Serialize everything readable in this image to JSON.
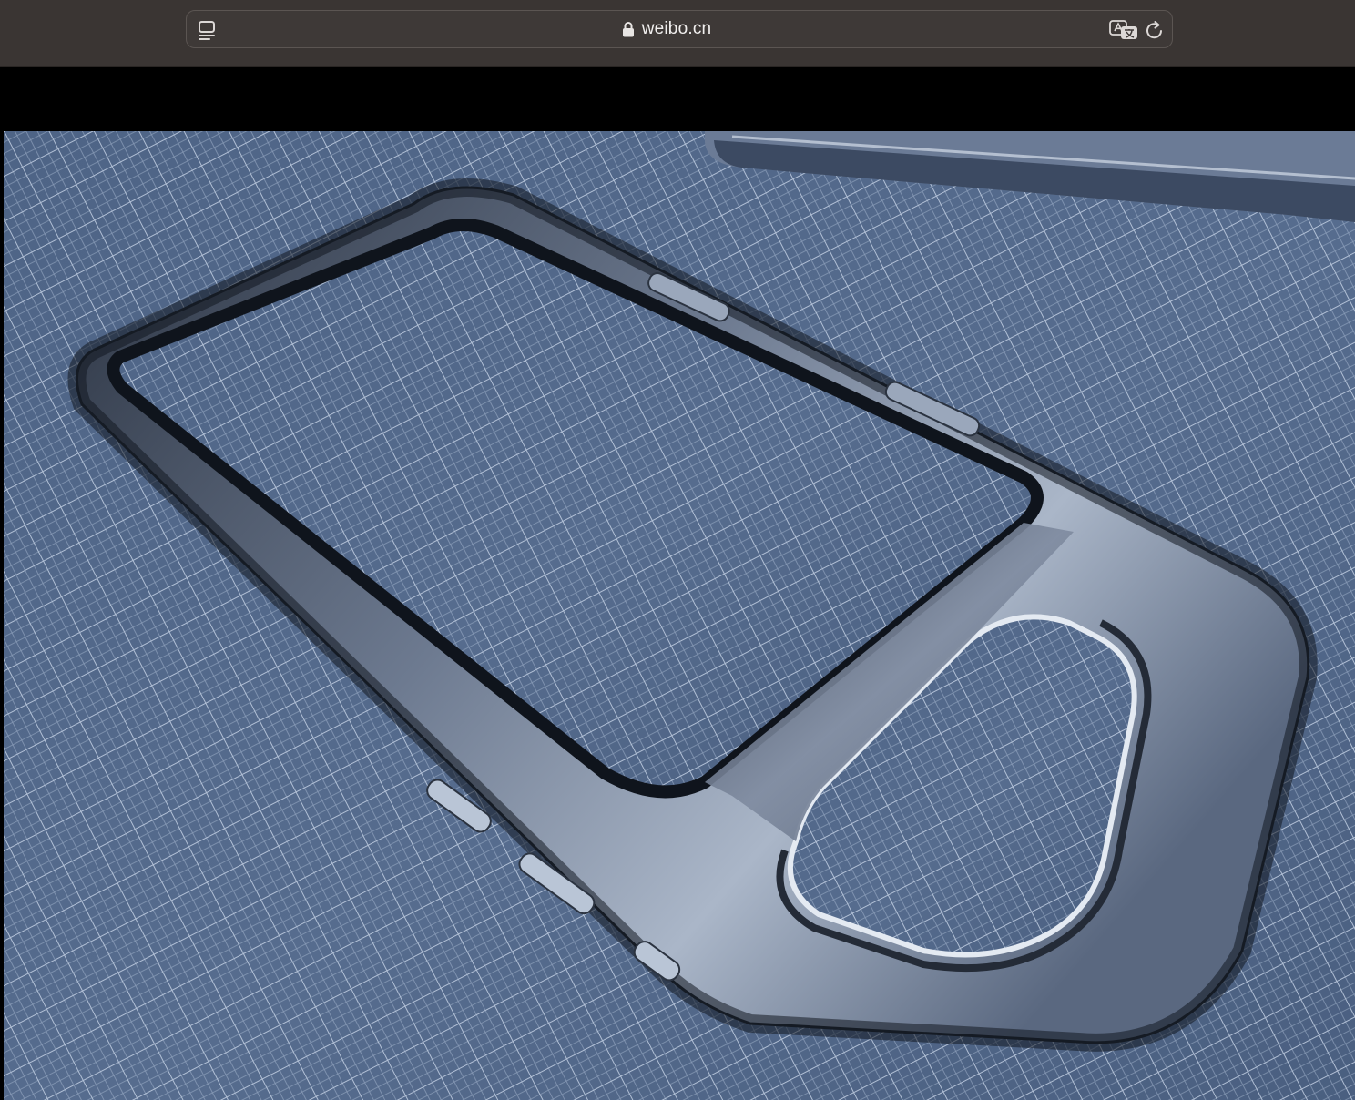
{
  "browser": {
    "url": "weibo.cn",
    "icons": {
      "tabs": "tab-overview-icon",
      "lock": "lock-icon",
      "translate": "translate-icon",
      "reload": "reload-icon"
    },
    "colors": {
      "toolbar": "#3a3533",
      "address_bar": "#3e3937",
      "text": "#f1efee"
    }
  },
  "content": {
    "image_subject": "phone-frame-photo",
    "colors": {
      "mat": "#53698a",
      "grid_line": "#c9d6e8",
      "frame_metal": "#5b6a82",
      "frame_dark": "#1d232e"
    }
  }
}
